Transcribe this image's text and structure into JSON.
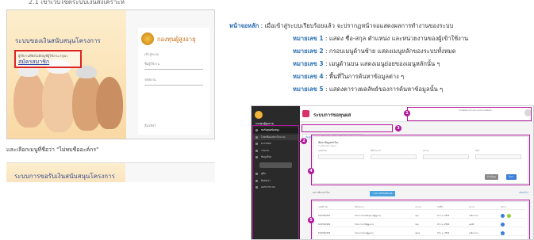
{
  "heading": "2.1 เข้าเว็บไซต์ระบบเงินสงเคราะห์",
  "login": {
    "title": "ระบบของเงินสนับสนุนโครงการ",
    "register_subtitle": "ผู้ใช้งานที่ยังไม่มีบัญชีผู้ใช้งาน กรุณา",
    "register_link": "สมัครสมาชิก",
    "logo_text": "กองทุนผู้สูงอายุ",
    "logo_sub": "เข้าสู่ระบบ",
    "username_label": "ชื่อผู้ใช้งาน",
    "password_label": "รหัสผ่าน",
    "footer": "ลืมรหัส?"
  },
  "caption": "และเลือกเมนูที่ชื่อว่า \"ไม่พบชื่ออะค์กร\"",
  "login2": {
    "title": "ระบบการขอรับเงินสนับสนุนโครงการ"
  },
  "description": {
    "main_label": "หน้าจอหลัก",
    "main_text": ": เมื่อเข้าสู่ระบบเรียบร้อยแล้ว จะปรากฏหน้าจอแสดงผลการทำงานของระบบ",
    "items": [
      {
        "label": "หมายเลข 1",
        "text": ": แสดง ชื่อ-สกุล ตำแหน่ง และหน่วยงานของผู้เข้าใช้งาน"
      },
      {
        "label": "หมายเลข 2",
        "text": ": กรอบเมนูด้านซ้าย แสดงเมนูหลักของระบบทั้งหมด"
      },
      {
        "label": "หมายเลข 3",
        "text": ": เมนูด้านบน แสดงเมนูย่อยของเมนูหลักนั้น ๆ"
      },
      {
        "label": "หมายเลข 4",
        "text": ": พื้นที่ในการค้นหาข้อมูลต่าง ๆ"
      },
      {
        "label": "หมายเลข 5",
        "text": ": แสดงตารางผลลัพธ์ของการค้นหาข้อมูลนั้น ๆ"
      }
    ]
  },
  "dashboard": {
    "brand": "กองทุนผู้สูงอายุ",
    "title": "ระบบการขอทุนผส",
    "user_info": "นายทดสอบ ตำแหน่ง หน่วยงานทดสอบ",
    "sidebar_items": [
      "ขอรับทุนสนับสนุน",
      "ไม่พบชื่อองค์กรในระบบ",
      "ตรวจสอบ",
      "รายงาน",
      "ข้อมูลอื่นๆ",
      "คู่มือ",
      "ติดต่อเรา",
      "ออกจากระบบ"
    ],
    "tabs": [
      "ข้อมูลโครงการ",
      "ข้อมูลผู้ยื่น",
      "ข้อมูลผู้ขอรับทุน"
    ],
    "search": {
      "title": "ค้นหาข้อมูลคำร้อง",
      "subtitle": "ระบุเงื่อนไขการค้นหา",
      "labels": [
        "เลขคำร้อง",
        "ชื่อโครงการ",
        "สถานะ",
        "วันที่"
      ],
      "btn_search": "ค้นหา",
      "btn_clear": "ล้างข้อมูล"
    },
    "results_bar": {
      "text": "ผลการค้นหาคำร้อง",
      "tab": "รายการคำร้องทั้งหมด",
      "right": "เพิ่มคำร้อง"
    },
    "table": {
      "headers": [
        "เลขที่คำร้อง",
        "ชื่อโครงการ",
        "ประเภท",
        "วันที่ยื่น",
        "สถานะ",
        "จัดการ"
      ],
      "rows": [
        [
          "64/2564/001",
          "โครงการส่งเสริมสุขภาพผู้สูงอายุ",
          "กลุ่ม",
          "21 ก.ค. 2564",
          "รอพิจารณา"
        ],
        [
          "64/2564/002",
          "โครงการอาชีพผู้สูงอายุ",
          "กลุ่ม",
          "22 ก.ค. 2564",
          "อนุมัติ"
        ],
        [
          "64/2564/003",
          "โครงการชมรมผู้สูงอายุ",
          "บุคคล",
          "23 ก.ค. 2564",
          "รอพิจารณา"
        ]
      ]
    }
  },
  "markers": [
    "1",
    "2",
    "3",
    "4",
    "5"
  ],
  "colors": {
    "annotation": "#b5179e",
    "label_blue": "#2c6fb3",
    "register_red": "#dd2222",
    "sidebar": "#2a2a2a"
  }
}
